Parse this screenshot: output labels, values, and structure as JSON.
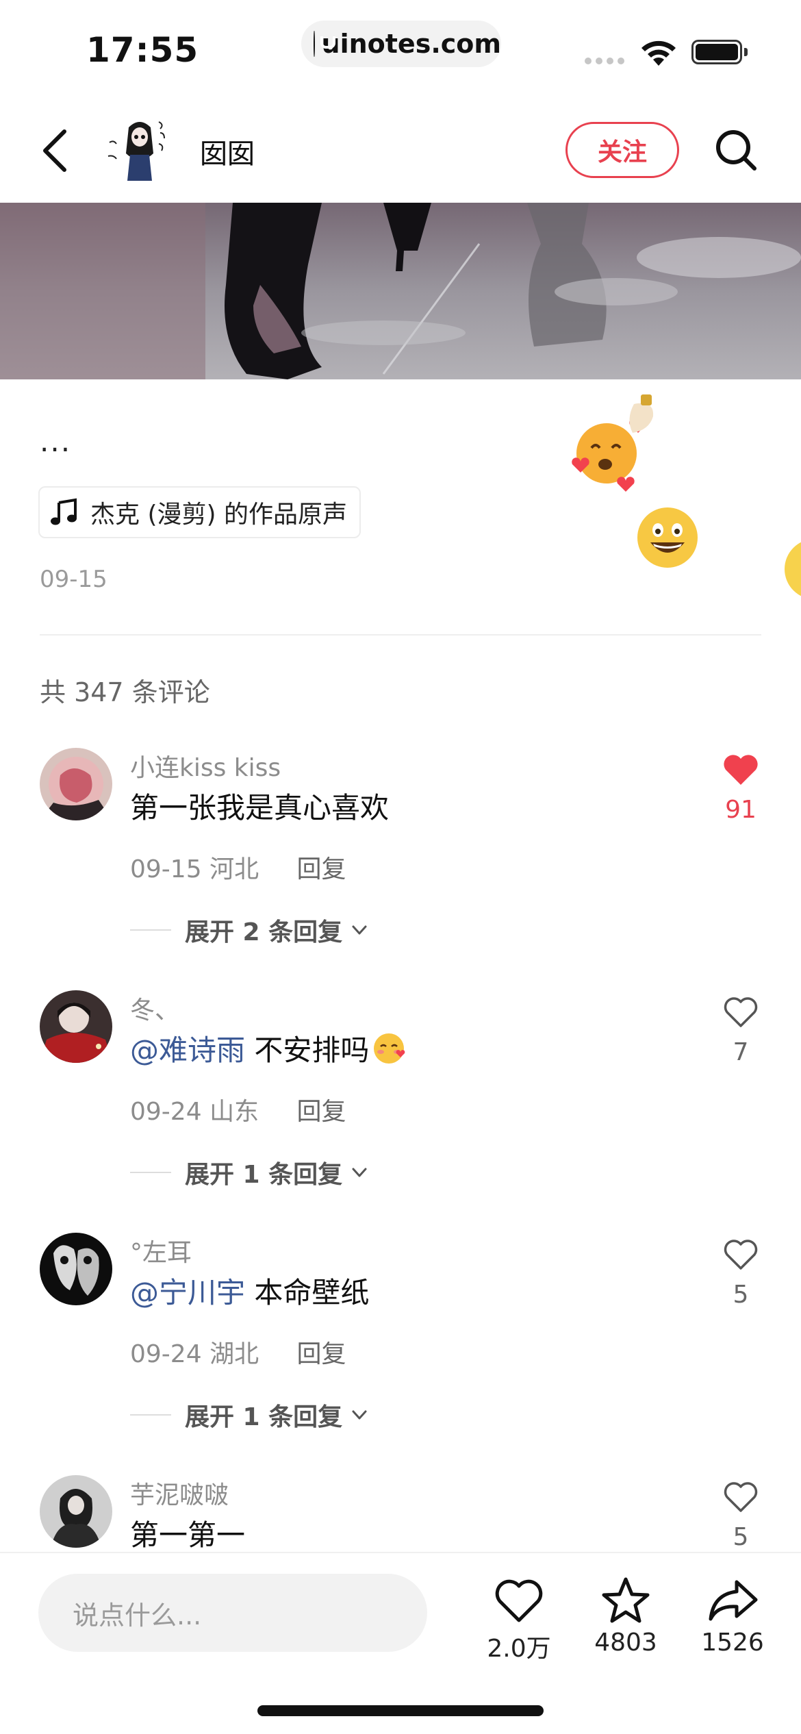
{
  "status_bar": {
    "time": "17:55",
    "url": "uinotes.com"
  },
  "header": {
    "author_name": "囡囡",
    "follow_label": "关注"
  },
  "post": {
    "caption": "...",
    "music": "杰克 (漫剪) 的作品原声",
    "date": "09-15"
  },
  "comments_section": {
    "count_label": "共 347 条评论",
    "comments": [
      {
        "user": "小连kiss kiss",
        "text": "第一张我是真心喜欢",
        "mention": "",
        "date": "09-15",
        "location": "河北",
        "reply_label": "回复",
        "expand_label": "展开 2 条回复",
        "likes": "91",
        "liked": true
      },
      {
        "user": "冬、",
        "mention": "@难诗雨",
        "text": " 不安排吗",
        "date": "09-24",
        "location": "山东",
        "reply_label": "回复",
        "expand_label": "展开 1 条回复",
        "likes": "7",
        "liked": false
      },
      {
        "user": "°左耳",
        "mention": "@宁川宇",
        "text": " 本命壁纸",
        "date": "09-24",
        "location": "湖北",
        "reply_label": "回复",
        "expand_label": "展开 1 条回复",
        "likes": "5",
        "liked": false
      },
      {
        "user": "芋泥啵啵",
        "mention": "",
        "text": "第一第一",
        "date": "",
        "location": "",
        "reply_label": "",
        "expand_label": "",
        "likes": "5",
        "liked": false
      }
    ]
  },
  "bottom_bar": {
    "input_placeholder": "说点什么...",
    "like_count": "2.0万",
    "collect_count": "4803",
    "share_count": "1526"
  },
  "colors": {
    "accent": "#e8414f",
    "mention": "#3c5a96",
    "muted": "#8c8c8c"
  },
  "icons": [
    "back-arrow-icon",
    "search-icon",
    "music-note-icon",
    "heart-icon",
    "star-icon",
    "share-icon",
    "chevron-down-icon"
  ]
}
